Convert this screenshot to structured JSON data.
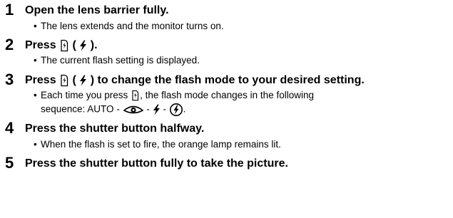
{
  "steps": [
    {
      "number": "1",
      "title": "Open the lens barrier fully.",
      "bullet": "The lens extends and the monitor turns on."
    },
    {
      "number": "2",
      "title_pre": "Press",
      "title_open": "(",
      "title_close": ").",
      "bullet": "The current flash setting is displayed."
    },
    {
      "number": "3",
      "title_pre": "Press",
      "title_open": "(",
      "title_post": ") to change the flash mode to your desired setting.",
      "bullet_pre": "Each time you press",
      "bullet_post": ", the flash mode changes in the following",
      "bullet_line2_pre": "sequence: AUTO -",
      "sep": "-",
      "end": "."
    },
    {
      "number": "4",
      "title": "Press the shutter button halfway.",
      "bullet": "When the flash is set to fire, the orange lamp remains lit."
    },
    {
      "number": "5",
      "title": "Press the shutter button fully to take the picture."
    }
  ],
  "icons": {
    "button": "flash-button-icon",
    "flash": "flash-bolt-icon",
    "redeye": "red-eye-reduction-icon",
    "forced": "forced-flash-icon"
  }
}
